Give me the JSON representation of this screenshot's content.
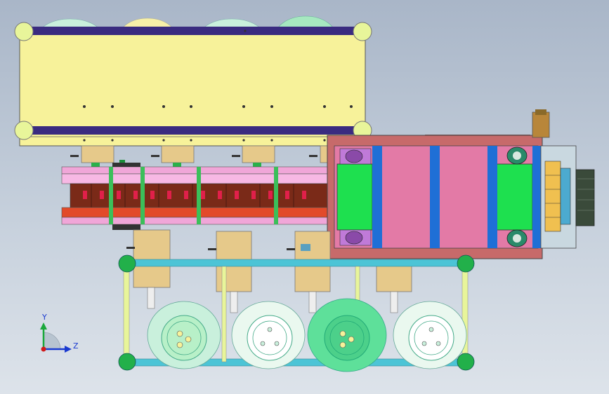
{
  "triad": {
    "y_label": "Y",
    "z_label": "Z"
  },
  "colors": {
    "background_top": "#a9b6c8",
    "background_bottom": "#dde3ea",
    "conveyor_panel": "#f7f29a",
    "rail": "#3a2b80",
    "corner_node": "#e8f59a",
    "frame_node": "#22b04a",
    "frame_bar": "#4cc4d6",
    "module_body": "#e6c98a",
    "drum": "#c9f0dc",
    "drum_green": "#5ee09a",
    "magenta_panel": "#e37aa6",
    "green_block": "#1ee04f",
    "blue_bar": "#1f6fd6",
    "track_pink": "#f0a6d8",
    "track_red": "#e24a2a",
    "track_brown": "#7a2a18",
    "brass": "#b8863a",
    "motor_dark": "#3a4a3a"
  }
}
